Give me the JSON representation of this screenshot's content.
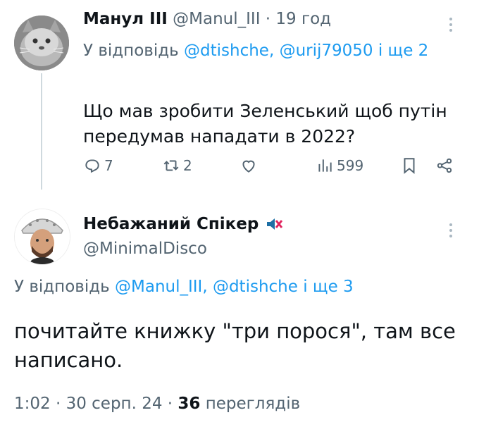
{
  "tweet1": {
    "avatar": "cat-avatar",
    "name": "Манул III",
    "handle": "@Manul_III",
    "sep": " · ",
    "time": "19 год",
    "reply_prefix": "У відповідь ",
    "reply_mentions": "@dtishche, @urij79050",
    "reply_suffix": " і ще 2",
    "text": "Що мав зробити Зеленський щоб путін передумав нападати в 2022?",
    "actions": {
      "replies": "7",
      "retweets": "2",
      "views": "599"
    },
    "icons": [
      "reply-icon",
      "retweet-icon",
      "like-icon",
      "views-icon",
      "bookmark-icon",
      "share-icon",
      "more-icon"
    ]
  },
  "tweet2": {
    "avatar": "man-helmet-avatar",
    "name": "Небажаний Спікер",
    "badge": "muted-speaker-emoji",
    "handle": "@MinimalDisco",
    "reply_prefix": "У відповідь ",
    "reply_mentions": "@Manul_III, @dtishche",
    "reply_suffix": " і ще 3",
    "text": "почитайте книжку \"три порося\", там все написано.",
    "time": "1:02 · 30 серп. 24 · ",
    "views_count": "36",
    "views_label": " переглядів"
  },
  "colors": {
    "accent": "#1d9bf0",
    "muted": "#536471",
    "text": "#0f1419",
    "line": "#cfd9de"
  }
}
